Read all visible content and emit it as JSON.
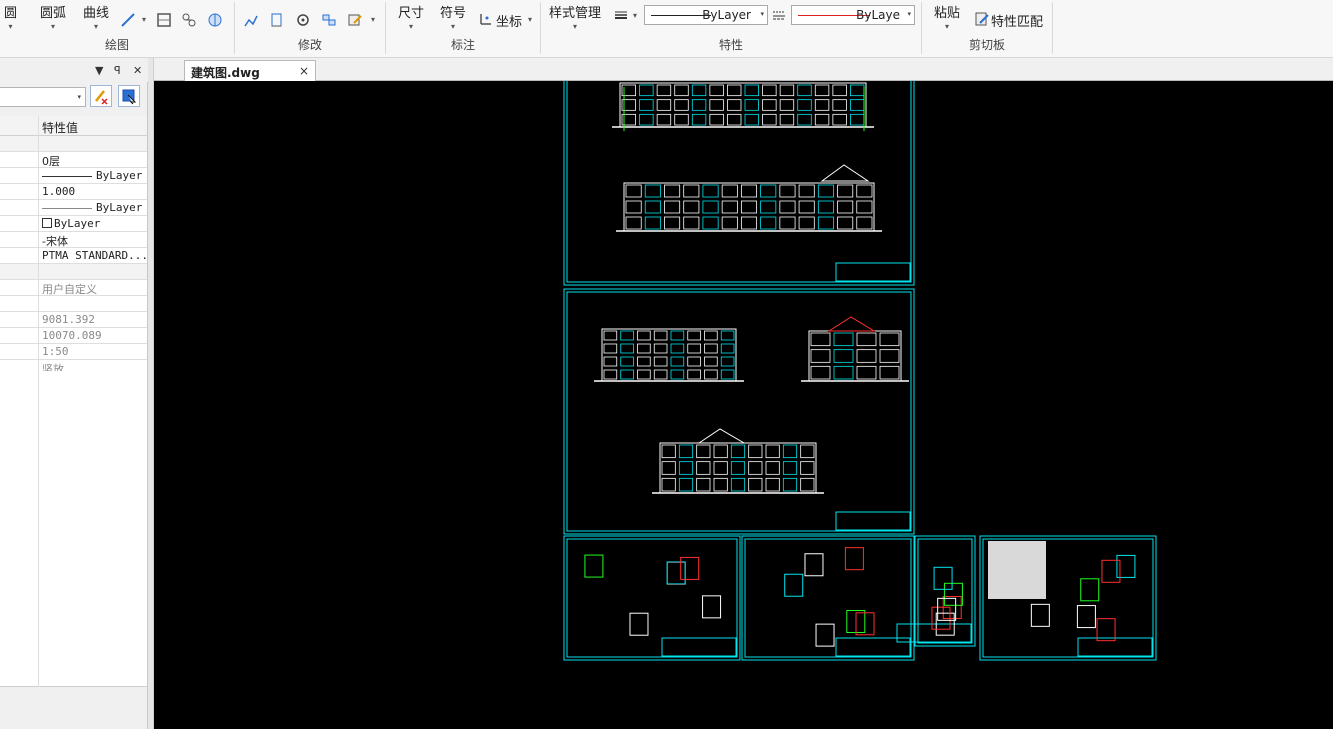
{
  "ribbon": {
    "draw": {
      "circle_label": "圆",
      "arc_label": "圆弧",
      "polyline_label": "曲线",
      "group_label": "绘图"
    },
    "modify": {
      "group_label": "修改"
    },
    "annotation": {
      "dimension_label": "尺寸",
      "symbol_label": "符号",
      "coord_label": "坐标",
      "group_label": "标注"
    },
    "properties": {
      "style_manager_label": "样式管理",
      "linetype_value": "ByLayer",
      "color_value": "ByLayе",
      "group_label": "特性"
    },
    "clipboard": {
      "paste_label": "粘贴",
      "match_label": "特性匹配",
      "group_label": "剪切板"
    }
  },
  "panel": {
    "header_value_col": "特性值",
    "rows": [
      {
        "value": ""
      },
      {
        "value": "0层"
      },
      {
        "value": "ByLayer"
      },
      {
        "value": "1.000"
      },
      {
        "value": "ByLayer"
      },
      {
        "value": "ByLayer"
      },
      {
        "value": "-宋体"
      },
      {
        "value": "PTMA STANDARD..."
      },
      {
        "value": ""
      },
      {
        "value": "用户自定义"
      },
      {
        "value": ""
      },
      {
        "value": "9081.392"
      },
      {
        "value": "10070.089"
      },
      {
        "value": "1:50"
      },
      {
        "value": "竖放"
      }
    ]
  },
  "tabs": {
    "active_label": "建筑图.dwg",
    "close_icon": "×"
  },
  "colors": {
    "canvas_bg": "#000000",
    "frame_cyan": "#00e5ee",
    "drawing_white": "#ffffff",
    "drawing_red": "#ff3030",
    "drawing_green": "#20ff20"
  }
}
